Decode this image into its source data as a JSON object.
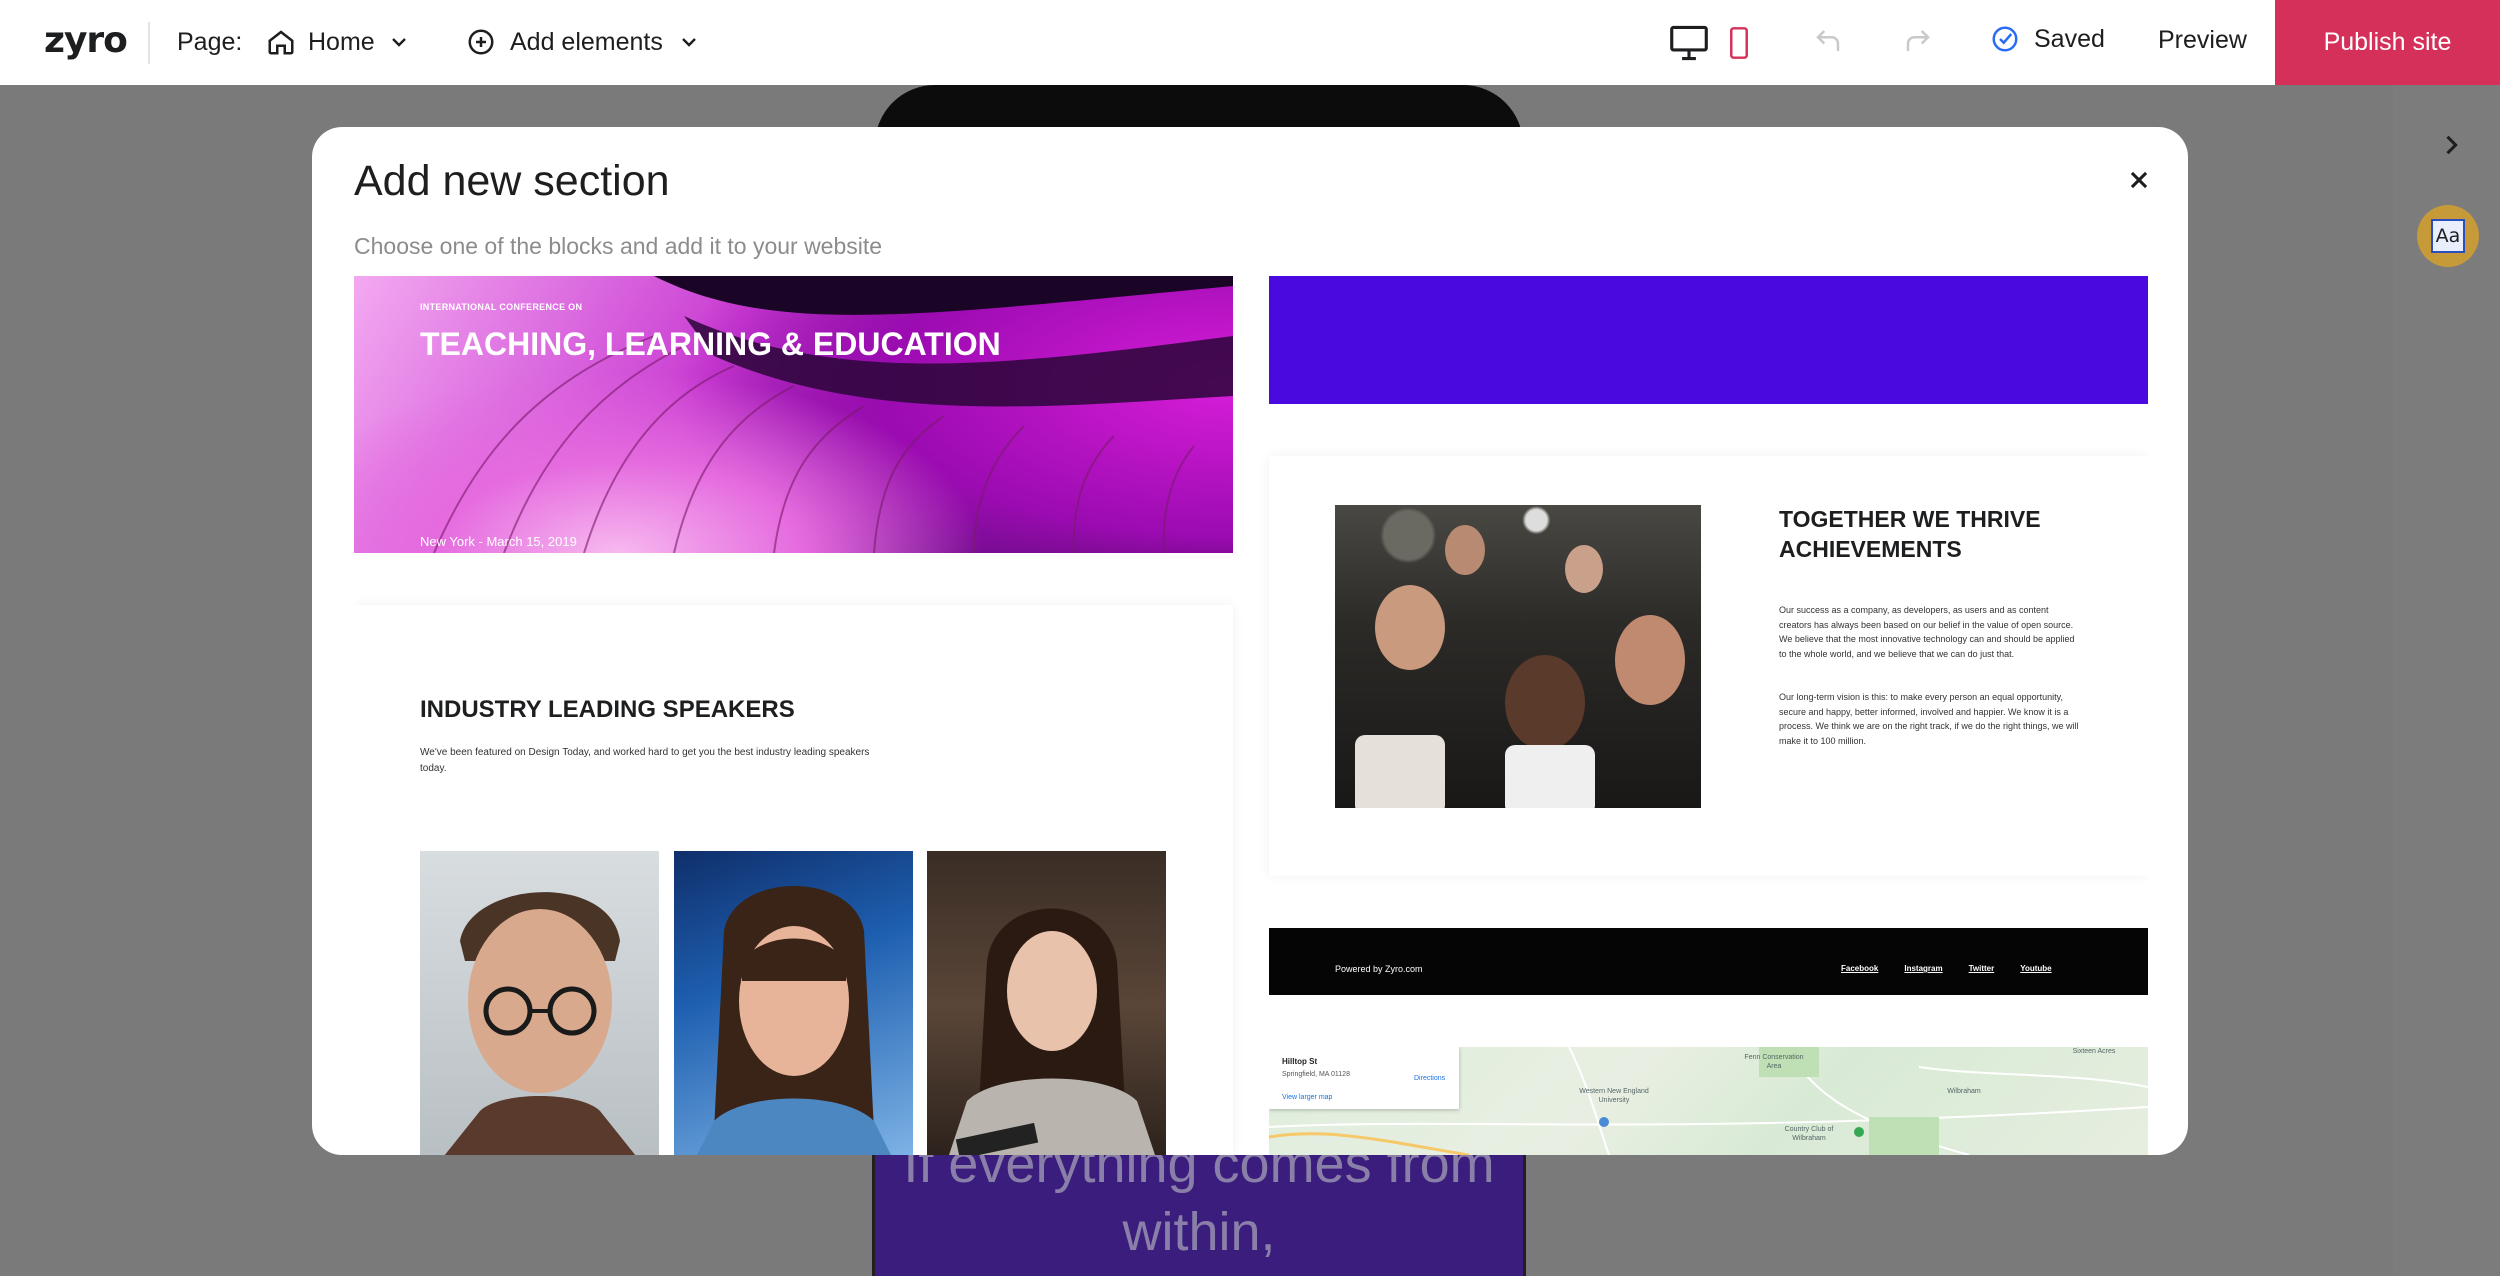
{
  "topbar": {
    "logo": "zyro",
    "page_label": "Page:",
    "current_page": "Home",
    "add_elements": "Add elements",
    "saved": "Saved",
    "preview": "Preview",
    "publish": "Publish site"
  },
  "colors": {
    "publish_bg": "#d5305a",
    "purple_block": "#4a0adf",
    "saved_check": "#2a6df4"
  },
  "canvas": {
    "quote": "If everything comes from within,"
  },
  "modal": {
    "title": "Add new section",
    "subtitle": "Choose one of the blocks and add it to your website",
    "blocks": {
      "hero": {
        "eyebrow": "INTERNATIONAL CONFERENCE ON",
        "title": "TEACHING, LEARNING & EDUCATION",
        "meta": "New York - March 15, 2019"
      },
      "thrive": {
        "title": "TOGETHER WE THRIVE ACHIEVEMENTS",
        "p1": "Our success as a company, as developers, as users and as content creators has always been based on our belief in the value of open source. We believe that the most innovative technology can and should be applied to the whole world, and we believe that we can do just that.",
        "p2": "Our long-term vision is this: to make every person an equal opportunity, secure and happy, better informed, involved and happier. We know it is a process. We think we are on the right track, if we do the right things, we will make it to 100 million."
      },
      "footer": {
        "powered": "Powered by Zyro.com",
        "links": [
          "Facebook",
          "Instagram",
          "Twitter",
          "Youtube"
        ]
      },
      "map": {
        "place": "Hilltop St",
        "address": "Springfield, MA 01128",
        "larger_map": "View larger map",
        "directions": "Directions",
        "labels": [
          "Fenn Conservation Area",
          "Western New England University",
          "Wilbraham",
          "Country Club of Wilbraham",
          "Sixteen Acres"
        ]
      },
      "speakers": {
        "title": "INDUSTRY LEADING SPEAKERS",
        "desc": "We've been featured on Design Today, and worked hard to get you the best industry leading speakers today."
      }
    }
  }
}
